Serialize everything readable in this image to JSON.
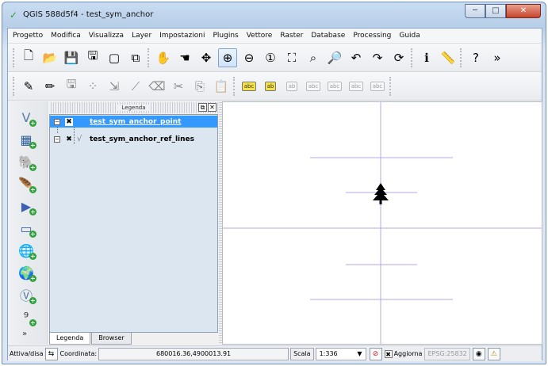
{
  "window": {
    "title": "QGIS 588d5f4 - test_sym_anchor",
    "minimize_glyph": "─",
    "maximize_glyph": "□",
    "close_glyph": "✕"
  },
  "menubar": {
    "items": [
      "Progetto",
      "Modifica",
      "Visualizza",
      "Layer",
      "Impostazioni",
      "Plugins",
      "Vettore",
      "Raster",
      "Database",
      "Processing",
      "Guida"
    ]
  },
  "toolbar1": {
    "buttons": [
      {
        "name": "new-project-icon",
        "glyph": "🗋"
      },
      {
        "name": "open-project-icon",
        "glyph": "📂"
      },
      {
        "name": "save-project-icon",
        "glyph": "💾"
      },
      {
        "name": "save-as-icon",
        "glyph": "🖫"
      },
      {
        "name": "new-print-composer-icon",
        "glyph": "▢"
      },
      {
        "name": "composer-manager-icon",
        "glyph": "⧉"
      },
      {
        "name": "touch-zoom-icon",
        "glyph": "✋"
      },
      {
        "name": "pan-icon",
        "glyph": "☚"
      },
      {
        "name": "pan-to-selection-icon",
        "glyph": "✥"
      },
      {
        "name": "zoom-in-icon",
        "glyph": "⊕",
        "active": true
      },
      {
        "name": "zoom-out-icon",
        "glyph": "⊖"
      },
      {
        "name": "zoom-native-icon",
        "glyph": "①"
      },
      {
        "name": "zoom-full-icon",
        "glyph": "⛶"
      },
      {
        "name": "zoom-to-selection-icon",
        "glyph": "⌕"
      },
      {
        "name": "zoom-to-layer-icon",
        "glyph": "🔎"
      },
      {
        "name": "zoom-last-icon",
        "glyph": "↶"
      },
      {
        "name": "zoom-next-icon",
        "glyph": "↷"
      },
      {
        "name": "refresh-icon",
        "glyph": "⟳"
      },
      {
        "name": "identify-icon",
        "glyph": "ℹ"
      },
      {
        "name": "measure-icon",
        "glyph": "📏"
      },
      {
        "name": "help-icon",
        "glyph": "?"
      }
    ],
    "overflow": "»"
  },
  "toolbar2": {
    "buttons": [
      {
        "name": "current-edits-icon",
        "glyph": "✎"
      },
      {
        "name": "toggle-editing-icon",
        "glyph": "✏"
      },
      {
        "name": "save-layer-edits-icon",
        "glyph": "🖫"
      },
      {
        "name": "add-feature-icon",
        "glyph": "⁘"
      },
      {
        "name": "move-feature-icon",
        "glyph": "⇲"
      },
      {
        "name": "node-tool-icon",
        "glyph": "⟋"
      },
      {
        "name": "delete-selected-icon",
        "glyph": "⌫"
      },
      {
        "name": "cut-features-icon",
        "glyph": "✂"
      },
      {
        "name": "copy-features-icon",
        "glyph": "⎘"
      },
      {
        "name": "paste-features-icon",
        "glyph": "📋"
      }
    ],
    "label_chips": [
      {
        "name": "label-tool-icon",
        "text": "abc",
        "yellow": true
      },
      {
        "name": "label-highlight-icon",
        "text": "ab",
        "yellow": true
      },
      {
        "name": "pin-label-icon",
        "text": "ab",
        "yellow": false
      },
      {
        "name": "show-hide-labels-icon",
        "text": "abc",
        "yellow": false
      },
      {
        "name": "move-label-icon",
        "text": "abc",
        "yellow": false
      },
      {
        "name": "rotate-label-icon",
        "text": "abc",
        "yellow": false
      },
      {
        "name": "change-label-icon",
        "text": "abc",
        "yellow": false
      }
    ]
  },
  "vtoolbar": {
    "buttons": [
      {
        "name": "add-vector-layer-icon",
        "glyph": "V"
      },
      {
        "name": "add-raster-layer-icon",
        "glyph": "▦"
      },
      {
        "name": "add-postgis-layer-icon",
        "glyph": "🐘"
      },
      {
        "name": "add-spatialite-layer-icon",
        "glyph": "🪶"
      },
      {
        "name": "add-mssql-layer-icon",
        "glyph": "▶"
      },
      {
        "name": "add-oracle-layer-icon",
        "glyph": "▭"
      },
      {
        "name": "add-wms-layer-icon",
        "glyph": "🌐"
      },
      {
        "name": "add-wcs-layer-icon",
        "glyph": "🌍"
      },
      {
        "name": "add-wfs-layer-icon",
        "glyph": "Ⓥ"
      },
      {
        "name": "add-delimited-text-layer-icon",
        "glyph": "⁹"
      }
    ],
    "more": "»"
  },
  "legend": {
    "title": "Legenda",
    "float_glyph": "⧉",
    "close_glyph": "✕",
    "collapse_glyph": "−",
    "layers": [
      {
        "name": "test_sym_anchor_point",
        "checked": "✖",
        "icon": "",
        "selected": true
      },
      {
        "name": "test_sym_anchor_ref_lines",
        "checked": "✖",
        "icon": "√",
        "selected": false
      }
    ],
    "tabs": [
      "Legenda",
      "Browser"
    ]
  },
  "map": {
    "symbol": "tree"
  },
  "statusbar": {
    "toggle_label": "Attiva/disa",
    "coord_label": "Coordinata:",
    "coord_value": "680016.36,4900013.91",
    "scale_label": "Scala",
    "scale_value": "1:336",
    "dropdown_glyph": "▼",
    "refresh_label": "Aggiorna",
    "refresh_checked": "✖",
    "epsg": "EPSG:25832"
  }
}
